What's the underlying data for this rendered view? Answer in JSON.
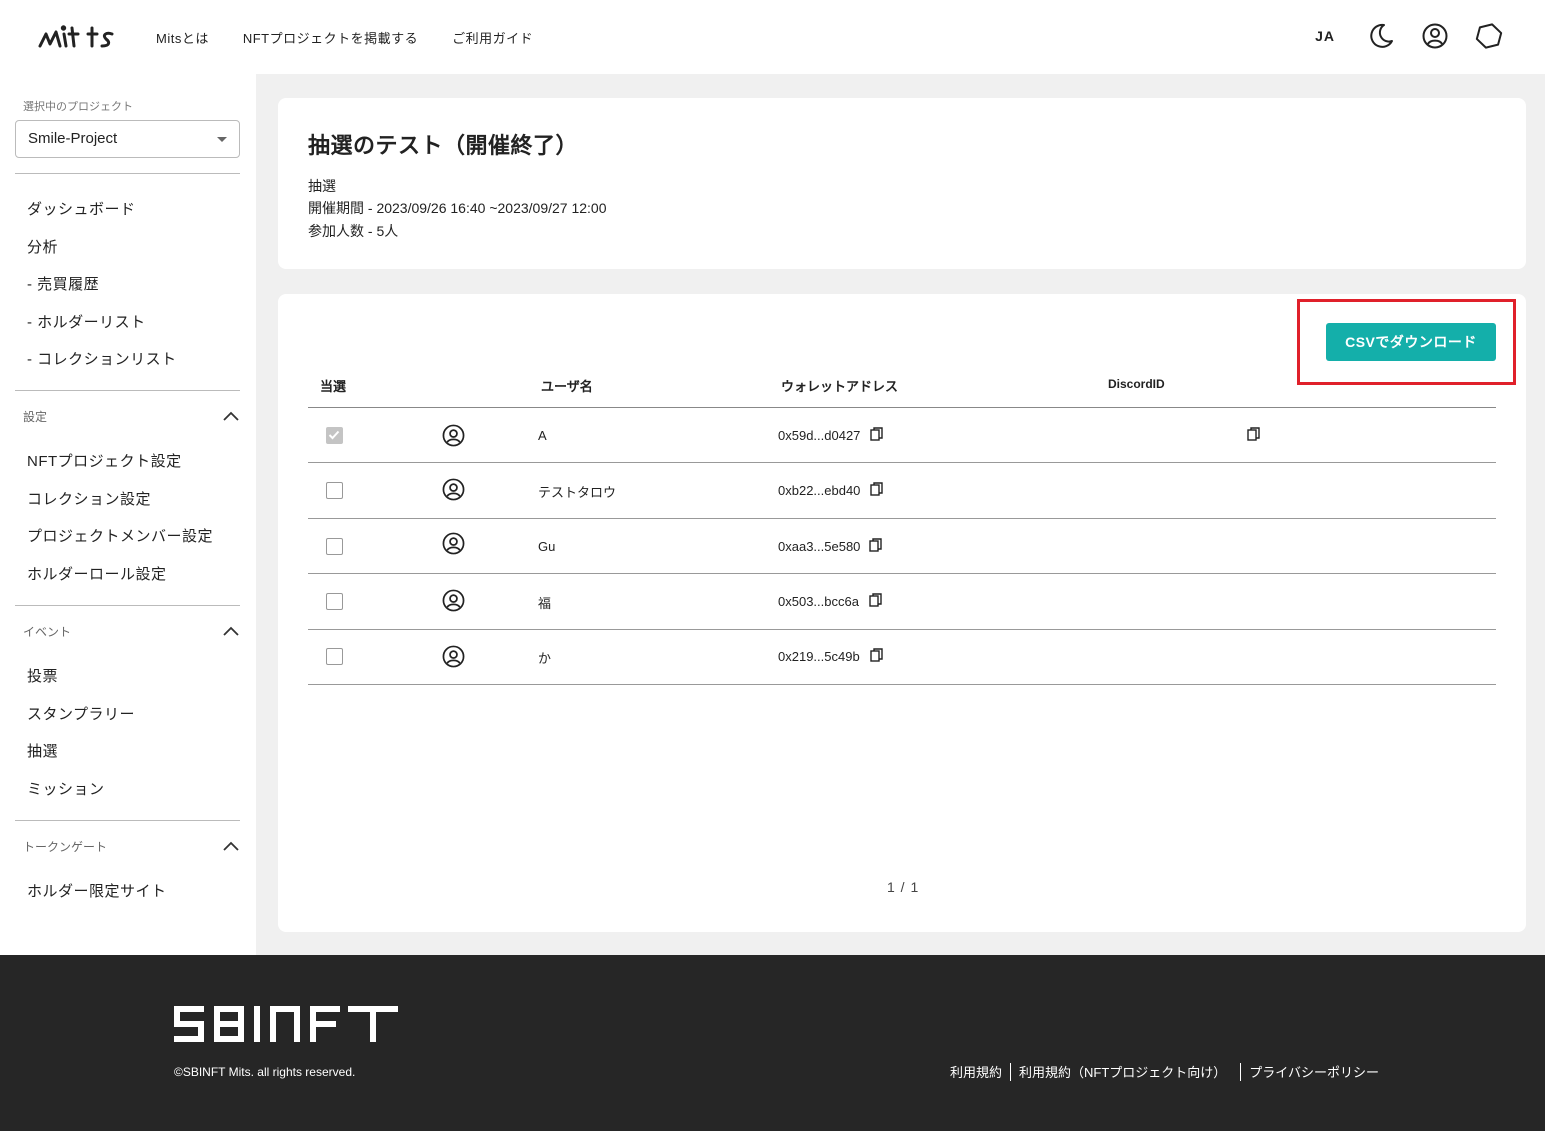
{
  "header": {
    "logo_alt": "mits",
    "nav": [
      "Mitsとは",
      "NFTプロジェクトを掲載する",
      "ご利用ガイド"
    ],
    "lang": "JA",
    "icons": [
      "moon-icon",
      "account-icon",
      "network-icon"
    ]
  },
  "sidebar": {
    "project_label": "選択中のプロジェクト",
    "project_value": "Smile-Project",
    "main_items": [
      "ダッシュボード",
      "分析",
      "- 売買履歴",
      "- ホルダーリスト",
      "- コレクションリスト"
    ],
    "settings": {
      "title": "設定",
      "items": [
        "NFTプロジェクト設定",
        "コレクション設定",
        "プロジェクトメンバー設定",
        "ホルダーロール設定"
      ]
    },
    "events": {
      "title": "イベント",
      "items": [
        "投票",
        "スタンプラリー",
        "抽選",
        "ミッション"
      ]
    },
    "token_gate": {
      "title": "トークンゲート",
      "items": [
        "ホルダー限定サイト"
      ]
    }
  },
  "lottery": {
    "title": "抽選のテスト（開催終了）",
    "type": "抽選",
    "period": "開催期間 - 2023/09/26 16:40 ~2023/09/27 12:00",
    "participants": "参加人数 - 5人"
  },
  "table": {
    "csv_button": "CSVでダウンロード",
    "columns": [
      "当選",
      "ユーザ名",
      "ウォレットアドレス",
      "DiscordID"
    ],
    "rows": [
      {
        "winner": true,
        "username": "A",
        "wallet": "0x59d...d0427",
        "discord_copy": true
      },
      {
        "winner": false,
        "username": "テストタロウ",
        "wallet": "0xb22...ebd40",
        "discord_copy": false
      },
      {
        "winner": false,
        "username": "Gu",
        "wallet": "0xaa3...5e580",
        "discord_copy": false
      },
      {
        "winner": false,
        "username": "福",
        "wallet": "0x503...bcc6a",
        "discord_copy": false
      },
      {
        "winner": false,
        "username": "か",
        "wallet": "0x219...5c49b",
        "discord_copy": false
      }
    ],
    "pagination": "1 / 1"
  },
  "footer": {
    "brand": "SBINFT",
    "copyright": "©SBINFT Mits. all rights reserved.",
    "links": [
      "利用規約",
      "利用規約（NFTプロジェクト向け）",
      "プライバシーポリシー"
    ]
  },
  "colors": {
    "accent": "#14afaa",
    "highlight": "#e0202a",
    "footer_bg": "#262626"
  }
}
